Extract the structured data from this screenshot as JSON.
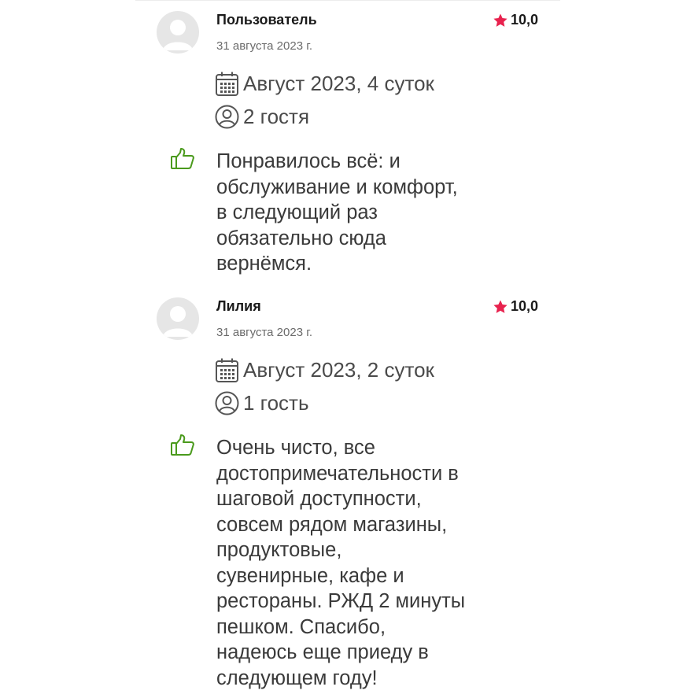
{
  "reviews": [
    {
      "author": "Пользователь",
      "rating": "10,0",
      "date": "31 августа 2023 г.",
      "stay": "Август 2023, 4 суток",
      "guests": "2 гостя",
      "text_lines": [
        "Понравилось всё: и",
        "обслуживание и комфорт,",
        "в следующий раз",
        "обязательно сюда",
        "вернёмся."
      ]
    },
    {
      "author": "Лилия",
      "rating": "10,0",
      "date": "31 августа 2023 г.",
      "stay": "Август 2023, 2 суток",
      "guests": "1 гость",
      "text_lines": [
        "Очень чисто, все",
        "достопримечательности в",
        "шаговой доступности,",
        "совсем рядом магазины,",
        "продуктовые,",
        "сувенирные, кафе и",
        "рестораны. РЖД 2 минуты",
        "пешком. Спасибо,",
        "надеюсь еще приеду в",
        "следующем году!"
      ]
    }
  ],
  "icons": {
    "avatar": "user-avatar-placeholder",
    "rating": "star-icon",
    "stay": "calendar-icon",
    "guests": "person-icon",
    "like": "thumbs-up-icon"
  },
  "colors": {
    "star": "#e8224e",
    "like": "#4a9a1c",
    "avatar_bg": "#e6e6e6",
    "avatar_fg": "#ffffff",
    "text": "#3a3a3a",
    "muted": "#6b6b6b"
  }
}
